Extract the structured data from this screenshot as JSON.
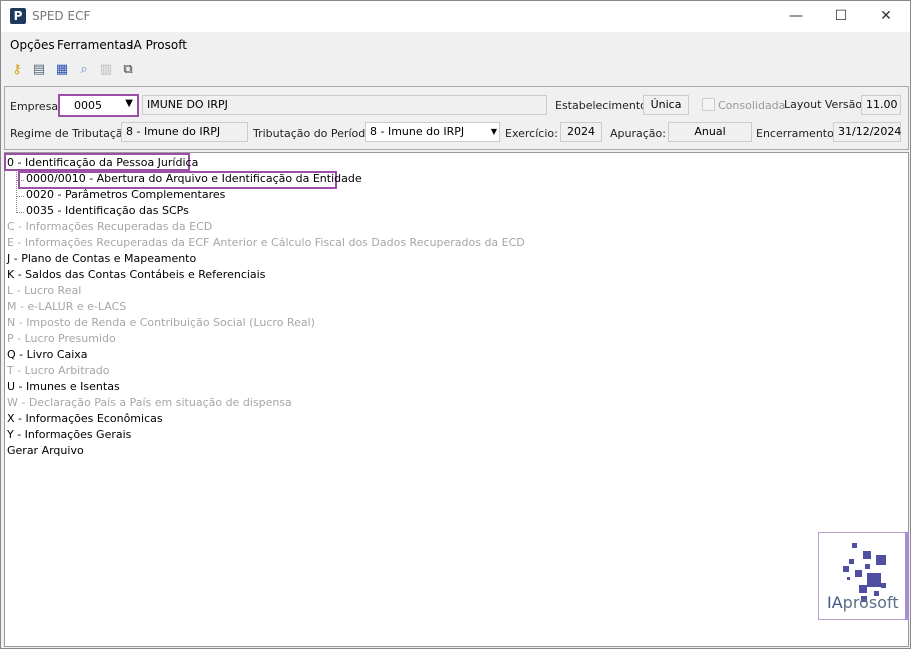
{
  "window": {
    "title": "SPED ECF",
    "minimize": "—",
    "maximize": "☐",
    "close": "✕",
    "app_icon": "P"
  },
  "menu": [
    "Opções",
    "Ferramentas",
    "IA Prosoft"
  ],
  "toolbar": [
    "key-icon",
    "settings-icon",
    "document-icon",
    "preview-icon",
    "table-icon",
    "copy-icon"
  ],
  "form": {
    "empresa_label": "Empresa:",
    "empresa_value": "0005",
    "empresa_name": "IMUNE DO IRPJ",
    "estabelecimento_label": "Estabelecimento:",
    "estabelecimento_value": "Única",
    "consolidada_label": "Consolidada",
    "consolidada_checked": false,
    "layout_label": "Layout Versão:",
    "layout_value": "11.00",
    "regime_label": "Regime de Tributação:",
    "regime_value": "8 - Imune do IRPJ",
    "tributacao_label": "Tributação do Período:",
    "tributacao_value": "8 - Imune do IRPJ",
    "exercicio_label": "Exercício:",
    "exercicio_value": "2024",
    "apuracao_label": "Apuração:",
    "apuracao_value": "Anual",
    "encerramento_label": "Encerramento:",
    "encerramento_value": "31/12/2024"
  },
  "tree": [
    {
      "label": "0 - Identificação da Pessoa Jurídica",
      "enabled": true,
      "level": 0
    },
    {
      "label": "0000/0010 - Abertura do Arquivo e Identificação da Entidade",
      "enabled": true,
      "level": 1
    },
    {
      "label": "0020 - Parâmetros Complementares",
      "enabled": true,
      "level": 1
    },
    {
      "label": "0035 - Identificação das SCPs",
      "enabled": true,
      "level": 1
    },
    {
      "label": "C - Informações Recuperadas da ECD",
      "enabled": false,
      "level": 0
    },
    {
      "label": "E - Informações Recuperadas da ECF Anterior e Cálculo Fiscal dos Dados Recuperados da ECD",
      "enabled": false,
      "level": 0
    },
    {
      "label": "J - Plano de Contas e Mapeamento",
      "enabled": true,
      "level": 0
    },
    {
      "label": "K - Saldos das Contas Contábeis e Referenciais",
      "enabled": true,
      "level": 0
    },
    {
      "label": "L - Lucro Real",
      "enabled": false,
      "level": 0
    },
    {
      "label": "M - e-LALUR e e-LACS",
      "enabled": false,
      "level": 0
    },
    {
      "label": "N - Imposto de Renda e Contribuição Social (Lucro Real)",
      "enabled": false,
      "level": 0
    },
    {
      "label": "P - Lucro Presumido",
      "enabled": false,
      "level": 0
    },
    {
      "label": "Q - Livro Caixa",
      "enabled": true,
      "level": 0
    },
    {
      "label": "T - Lucro Arbitrado",
      "enabled": false,
      "level": 0
    },
    {
      "label": "U - Imunes e Isentas",
      "enabled": true,
      "level": 0
    },
    {
      "label": "W - Declaração País a País em situação de dispensa",
      "enabled": false,
      "level": 0
    },
    {
      "label": "X - Informações Econômicas",
      "enabled": true,
      "level": 0
    },
    {
      "label": "Y - Informações Gerais",
      "enabled": true,
      "level": 0
    },
    {
      "label": "Gerar Arquivo",
      "enabled": true,
      "level": 0
    }
  ],
  "logo": {
    "text_a": "IA",
    "text_b": "prosoft"
  },
  "colors": {
    "highlight": "#9b4fa6",
    "disabled": "#a6a6a6"
  }
}
